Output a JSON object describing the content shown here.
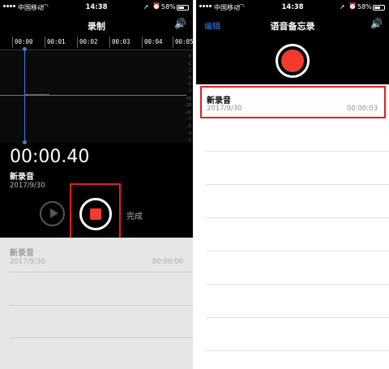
{
  "status_bar": {
    "carrier": "中国移动",
    "time": "14:38",
    "battery_percent": "58%"
  },
  "recording_screen": {
    "title": "录制",
    "timeline_ticks": [
      "00:00",
      "00:01",
      "00:02",
      "00:03",
      "00:04",
      "00:05"
    ],
    "scale_labels": [
      "0",
      "-1",
      "-2",
      "-3",
      "-5",
      "-7",
      "-10",
      "-20",
      "-10",
      "-7",
      "-5",
      "-3",
      "-2",
      "-1",
      "0"
    ],
    "elapsed": "00:00.40",
    "recording_name": "新录音",
    "recording_date": "2017/9/30",
    "done_label": "完成",
    "list_item": {
      "name": "新录音",
      "date": "2017/9/30",
      "duration": "00:00:00"
    }
  },
  "memos_screen": {
    "edit_label": "编辑",
    "title": "语音备忘录",
    "list_item": {
      "name": "新录音",
      "date": "2017/9/30",
      "duration": "00:00:03"
    }
  },
  "colors": {
    "record_red": "#f23a2f",
    "highlight_red": "#e02020",
    "accent_blue": "#2b86f2"
  }
}
